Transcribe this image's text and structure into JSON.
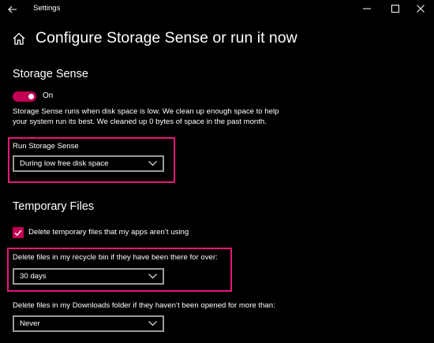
{
  "window": {
    "title": "Settings",
    "back_icon": "back-arrow-icon",
    "controls": [
      "minimize-icon",
      "maximize-icon",
      "close-icon"
    ]
  },
  "header": {
    "home_icon": "home-icon",
    "title": "Configure Storage Sense or run it now"
  },
  "storage_sense": {
    "section_title": "Storage Sense",
    "toggle_state": "On",
    "toggle_on": true,
    "description": "Storage Sense runs when disk space is low. We clean up enough space to help your system run its best. We cleaned up 0 bytes of space in the past month.",
    "run_label": "Run Storage Sense",
    "run_value": "During low free disk space"
  },
  "temporary_files": {
    "section_title": "Temporary Files",
    "checkbox_label": "Delete temporary files that my apps aren’t using",
    "checkbox_checked": true,
    "recycle_label": "Delete files in my recycle bin if they have been there for over:",
    "recycle_value": "30 days",
    "downloads_label": "Delete files in my Downloads folder if they haven’t been opened for more than:",
    "downloads_value": "Never"
  },
  "colors": {
    "accent": "#c30052",
    "highlight_border": "#e5177a",
    "background": "#000000"
  }
}
